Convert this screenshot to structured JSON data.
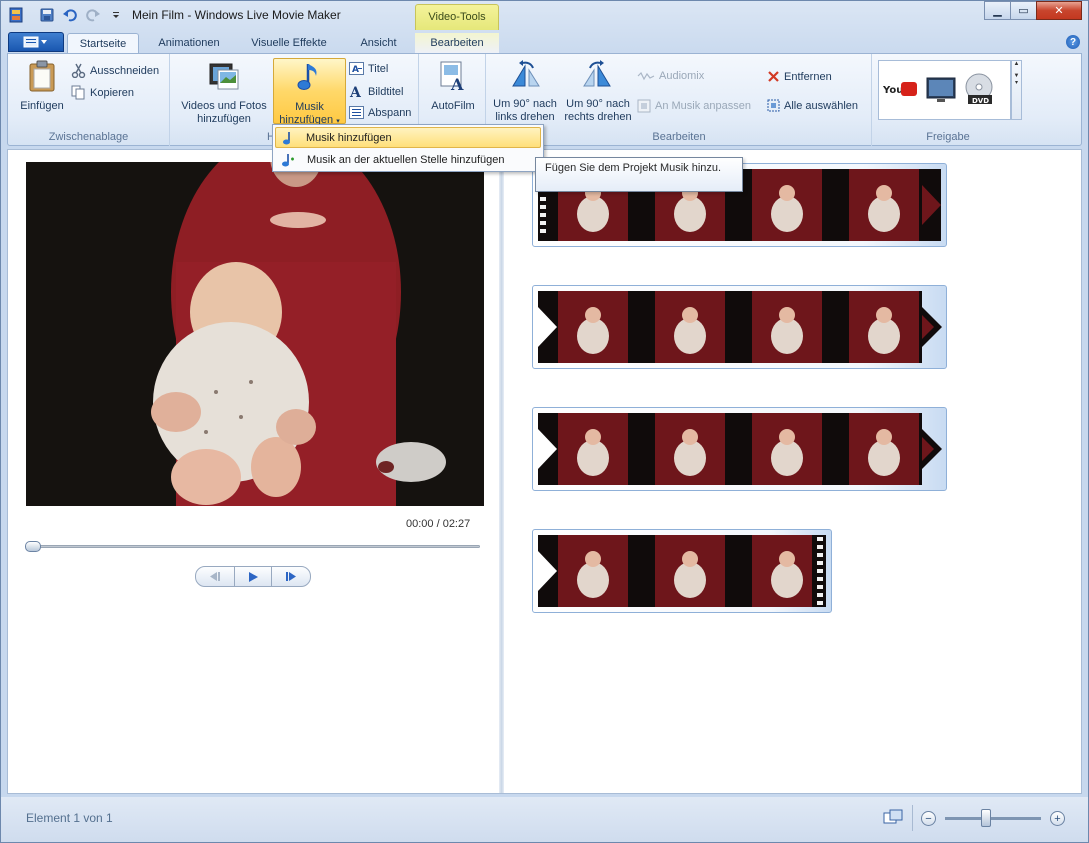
{
  "window": {
    "title": "Mein Film - Windows Live Movie Maker",
    "context_tab": "Video-Tools"
  },
  "tabs": [
    {
      "label": "Startseite",
      "active": true
    },
    {
      "label": "Animationen",
      "active": false
    },
    {
      "label": "Visuelle Effekte",
      "active": false
    },
    {
      "label": "Ansicht",
      "active": false
    },
    {
      "label": "Bearbeiten",
      "active": false
    }
  ],
  "ribbon": {
    "clipboard": {
      "label": "Zwischenablage",
      "paste": "Einfügen",
      "cut": "Ausschneiden",
      "copy": "Kopieren"
    },
    "add": {
      "label": "H",
      "videos_line1": "Videos und Fotos",
      "videos_line2": "hinzufügen",
      "music_line1": "Musik",
      "music_line2": "hinzufügen",
      "title": "Titel",
      "caption": "Bildtitel",
      "credits": "Abspann"
    },
    "autofilm": "AutoFilm",
    "edit": {
      "label": "Bearbeiten",
      "rotate_left_line1": "Um 90° nach",
      "rotate_left_line2": "links drehen",
      "rotate_right_line1": "Um 90° nach",
      "rotate_right_line2": "rechts drehen",
      "audiomix": "Audiomix",
      "fit_music": "An Musik anpassen",
      "remove": "Entfernen",
      "select_all": "Alle auswählen"
    },
    "share": {
      "label": "Freigabe",
      "youtube": "YouTube",
      "dvd": "DVD"
    }
  },
  "menu": {
    "items": [
      "Musik hinzufügen",
      "Musik an der aktuellen Stelle hinzufügen"
    ],
    "tooltip": "Fügen Sie dem Projekt Musik hinzu."
  },
  "preview": {
    "time": "00:00 / 02:27",
    "seek_position": 0
  },
  "status": {
    "text": "Element 1 von 1",
    "zoom_level": 0.42
  },
  "colors": {
    "accent": "#1f5cb4",
    "highlight": "#ffd869",
    "context": "#f4f39a"
  }
}
